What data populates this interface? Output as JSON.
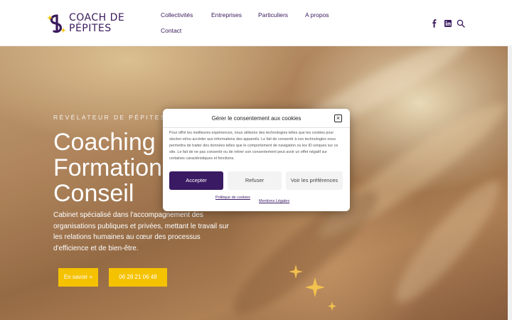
{
  "brand": {
    "line1": "COACH DE",
    "line2": "PÉPITES",
    "primary": "#3a1a5c",
    "accent": "#f5c200"
  },
  "nav": {
    "items": [
      "Collectivités",
      "Entreprises",
      "Particuliers",
      "A propos",
      "Contact"
    ]
  },
  "social": {
    "facebook": "facebook-icon",
    "linkedin": "linkedin-icon",
    "search": "search-icon"
  },
  "hero": {
    "kicker": "RÉVÉLATEUR DE PÉPITES HUMAINES",
    "headlines": [
      "Coaching",
      "Formation",
      "Conseil"
    ],
    "description": "Cabinet spécialisé dans l'accompagnement des organisations publiques et privées, mettant le travail sur les relations humaines au cœur des processus d'efficience et de bien-être.",
    "btn_more": "En savoir +",
    "btn_phone": "06 28 21 06 48"
  },
  "consent": {
    "title": "Gérer le consentement aux cookies",
    "body": "Pour offrir les meilleures expériences, nous utilisons des technologies telles que les cookies pour stocker et/ou accéder aux informations des appareils. Le fait de consentir à ces technologies nous permettra de traiter des données telles que le comportement de navigation ou les ID uniques sur ce site. Le fait de ne pas consentir ou de retirer son consentement peut avoir un effet négatif sur certaines caractéristiques et fonctions.",
    "accept": "Accepter",
    "refuse": "Refuser",
    "preferences": "Voir les préférences",
    "cookie_policy": "Politique de cookies",
    "legal": "Mentions Légales",
    "close_icon": "close-icon"
  }
}
